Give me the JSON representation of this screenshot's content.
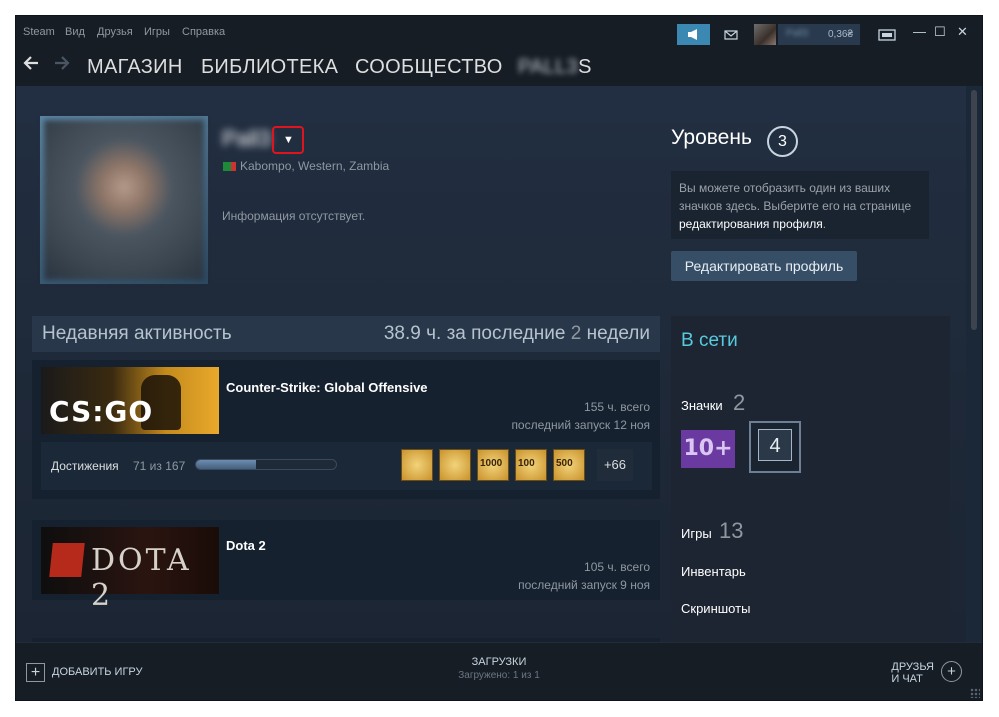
{
  "titlebar": {
    "menu": [
      "Steam",
      "Вид",
      "Друзья",
      "Игры",
      "Справка"
    ],
    "wallet": "0,36₴",
    "username": "Pall3",
    "controls": [
      "▭",
      "—",
      "☐",
      "✕"
    ]
  },
  "nav": {
    "back_icon": "arrow-left-icon",
    "forward_icon": "arrow-right-icon",
    "links": [
      "МАГАЗИН",
      "БИБЛИОТЕКА",
      "СООБЩЕСТВО"
    ],
    "user_blurred": "PALL3",
    "user_tail": "S"
  },
  "profile": {
    "name_blurred": "Pall3",
    "dropdown_glyph": "▼",
    "location": "Kabompo, Western, Zambia",
    "summary": "Информация отсутствует.",
    "level_label": "Уровень",
    "level": "3",
    "badge_info_text": "Вы можете отобразить один из ваших значков здесь. Выберите его на странице ",
    "badge_info_link": "редактирования профиля",
    "badge_info_end": ".",
    "edit_button": "Редактировать профиль"
  },
  "activity": {
    "title": "Недавняя активность",
    "hours_prefix": "38.9 ч. за последние ",
    "hours_num": "2",
    "hours_suffix": " недели",
    "games": [
      {
        "name": "Counter-Strike: Global Offensive",
        "total": "155 ч. всего",
        "last": "последний запуск 12 ноя",
        "logo": "CS:GO"
      },
      {
        "name": "Dota 2",
        "total": "105 ч. всего",
        "last": "последний запуск 9 ноя",
        "logo": "DOTA 2"
      }
    ],
    "achievements": {
      "label": "Достижения",
      "count": "71 из 167",
      "progress": 0.425,
      "icons": [
        "",
        "",
        "1000",
        "100",
        "500"
      ],
      "more": "+66"
    }
  },
  "sidebar": {
    "online": "В сети",
    "badges_label": "Значки",
    "badges_count": "2",
    "badge_level": "10+",
    "badge_num": "4",
    "games_label": "Игры",
    "games_count": "13",
    "inventory": "Инвентарь",
    "screenshots": "Скриншоты"
  },
  "bottombar": {
    "add_game": "ДОБАВИТЬ ИГРУ",
    "downloads_title": "ЗАГРУЗКИ",
    "downloads_status": "Загружено: 1 из 1",
    "friends_line1": "ДРУЗЬЯ",
    "friends_line2": "И ЧАТ"
  }
}
